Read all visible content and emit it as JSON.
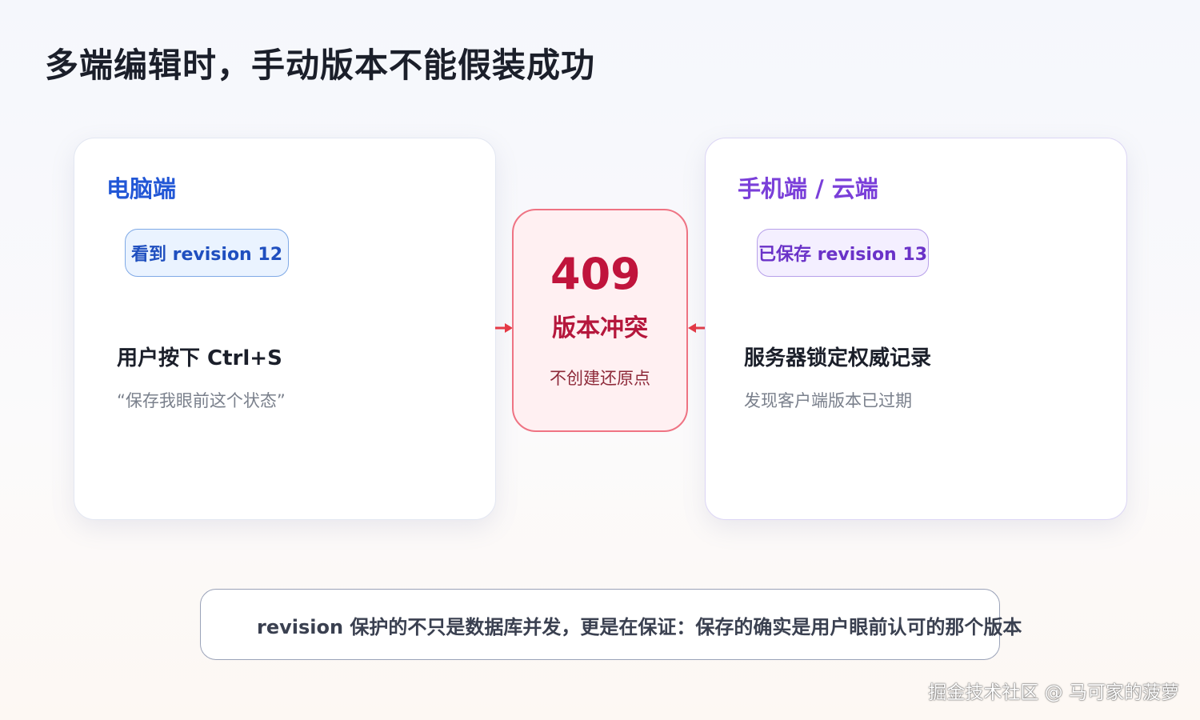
{
  "title": "多端编辑时，手动版本不能假装成功",
  "left_card": {
    "heading": "电脑端",
    "badge": "看到 revision 12",
    "action": "用户按下 Ctrl+S",
    "description": "“保存我眼前这个状态”"
  },
  "conflict": {
    "code": "409",
    "label": "版本冲突",
    "sub": "不创建还原点"
  },
  "right_card": {
    "heading": "手机端 / 云端",
    "badge": "已保存 revision 13",
    "action": "服务器锁定权威记录",
    "description": "发现客户端版本已过期"
  },
  "note": "revision 保护的不只是数据库并发，更是在保证：保存的确实是用户眼前认可的那个版本",
  "watermark": "掘金技术社区 @ 马可家的菠萝",
  "colors": {
    "left_accent": "#2257d6",
    "right_accent": "#7a3fd9",
    "conflict_accent": "#c0143c",
    "arrow": "#e53945"
  }
}
